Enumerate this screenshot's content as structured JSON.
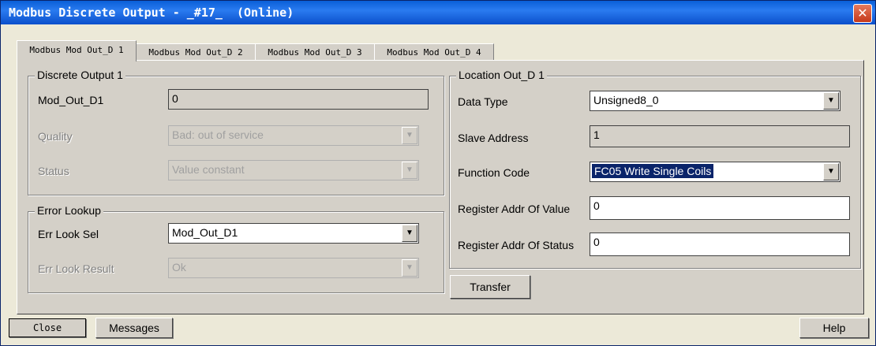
{
  "window": {
    "title": "Modbus Discrete Output - _#17_  (Online)",
    "close_glyph": "✕"
  },
  "tabs": [
    {
      "label": "Modbus Mod Out_D 1"
    },
    {
      "label": "Modbus Mod Out_D 2"
    },
    {
      "label": "Modbus Mod Out_D 3"
    },
    {
      "label": "Modbus Mod Out_D 4"
    }
  ],
  "discrete_output": {
    "title": "Discrete Output 1",
    "mod_out_label": "Mod_Out_D1",
    "mod_out_value": "0",
    "quality_label": "Quality",
    "quality_value": "Bad: out of service",
    "status_label": "Status",
    "status_value": "Value constant"
  },
  "error_lookup": {
    "title": "Error Lookup",
    "sel_label": "Err Look Sel",
    "sel_value": "Mod_Out_D1",
    "result_label": "Err Look Result",
    "result_value": "Ok"
  },
  "location": {
    "title": "Location Out_D 1",
    "data_type_label": "Data Type",
    "data_type_value": "Unsigned8_0",
    "slave_address_label": "Slave Address",
    "slave_address_value": "1",
    "function_code_label": "Function Code",
    "function_code_value": "FC05 Write Single Coils",
    "reg_value_label": "Register Addr Of Value",
    "reg_value_value": "0",
    "reg_status_label": "Register Addr Of Status",
    "reg_status_value": "0"
  },
  "buttons": {
    "transfer": "Transfer",
    "close": "Close",
    "messages": "Messages",
    "help": "Help"
  },
  "icons": {
    "dropdown_arrow": "▼"
  }
}
